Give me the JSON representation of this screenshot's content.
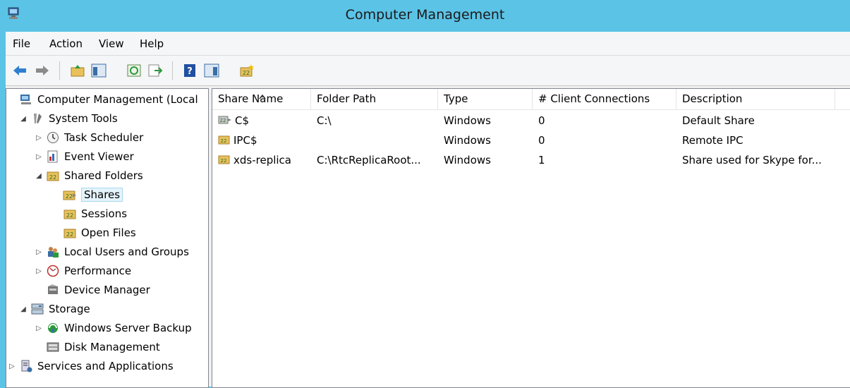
{
  "window": {
    "title": "Computer Management",
    "app_icon": "computer-management-icon"
  },
  "menu": [
    "File",
    "Action",
    "View",
    "Help"
  ],
  "toolbar": {
    "icons": [
      "back-arrow-icon",
      "forward-arrow-icon",
      "up-folder-icon",
      "show-hide-console-tree-icon",
      "refresh-icon",
      "export-list-icon",
      "help-icon",
      "show-hide-action-pane-icon",
      "new-share-icon"
    ]
  },
  "tree": {
    "root": "Computer Management (Local",
    "system_tools": "System Tools",
    "task_scheduler": "Task Scheduler",
    "event_viewer": "Event Viewer",
    "shared_folders": "Shared Folders",
    "shares": "Shares",
    "sessions": "Sessions",
    "open_files": "Open Files",
    "local_users": "Local Users and Groups",
    "performance": "Performance",
    "device_manager": "Device Manager",
    "storage": "Storage",
    "backup": "Windows Server Backup",
    "disk_management": "Disk Management",
    "services": "Services and Applications"
  },
  "list": {
    "columns": [
      "Share Name",
      "Folder Path",
      "Type",
      "# Client Connections",
      "Description"
    ],
    "rows": [
      {
        "name": "C$",
        "path": "C:\\",
        "type": "Windows",
        "connections": "0",
        "description": "Default Share"
      },
      {
        "name": "IPC$",
        "path": "",
        "type": "Windows",
        "connections": "0",
        "description": "Remote IPC"
      },
      {
        "name": "xds-replica",
        "path": "C:\\RtcReplicaRoot...",
        "type": "Windows",
        "connections": "1",
        "description": "Share used for Skype for..."
      }
    ]
  },
  "colors": {
    "titlebar": "#5bc3e6",
    "selection": "#e5f3fb"
  }
}
